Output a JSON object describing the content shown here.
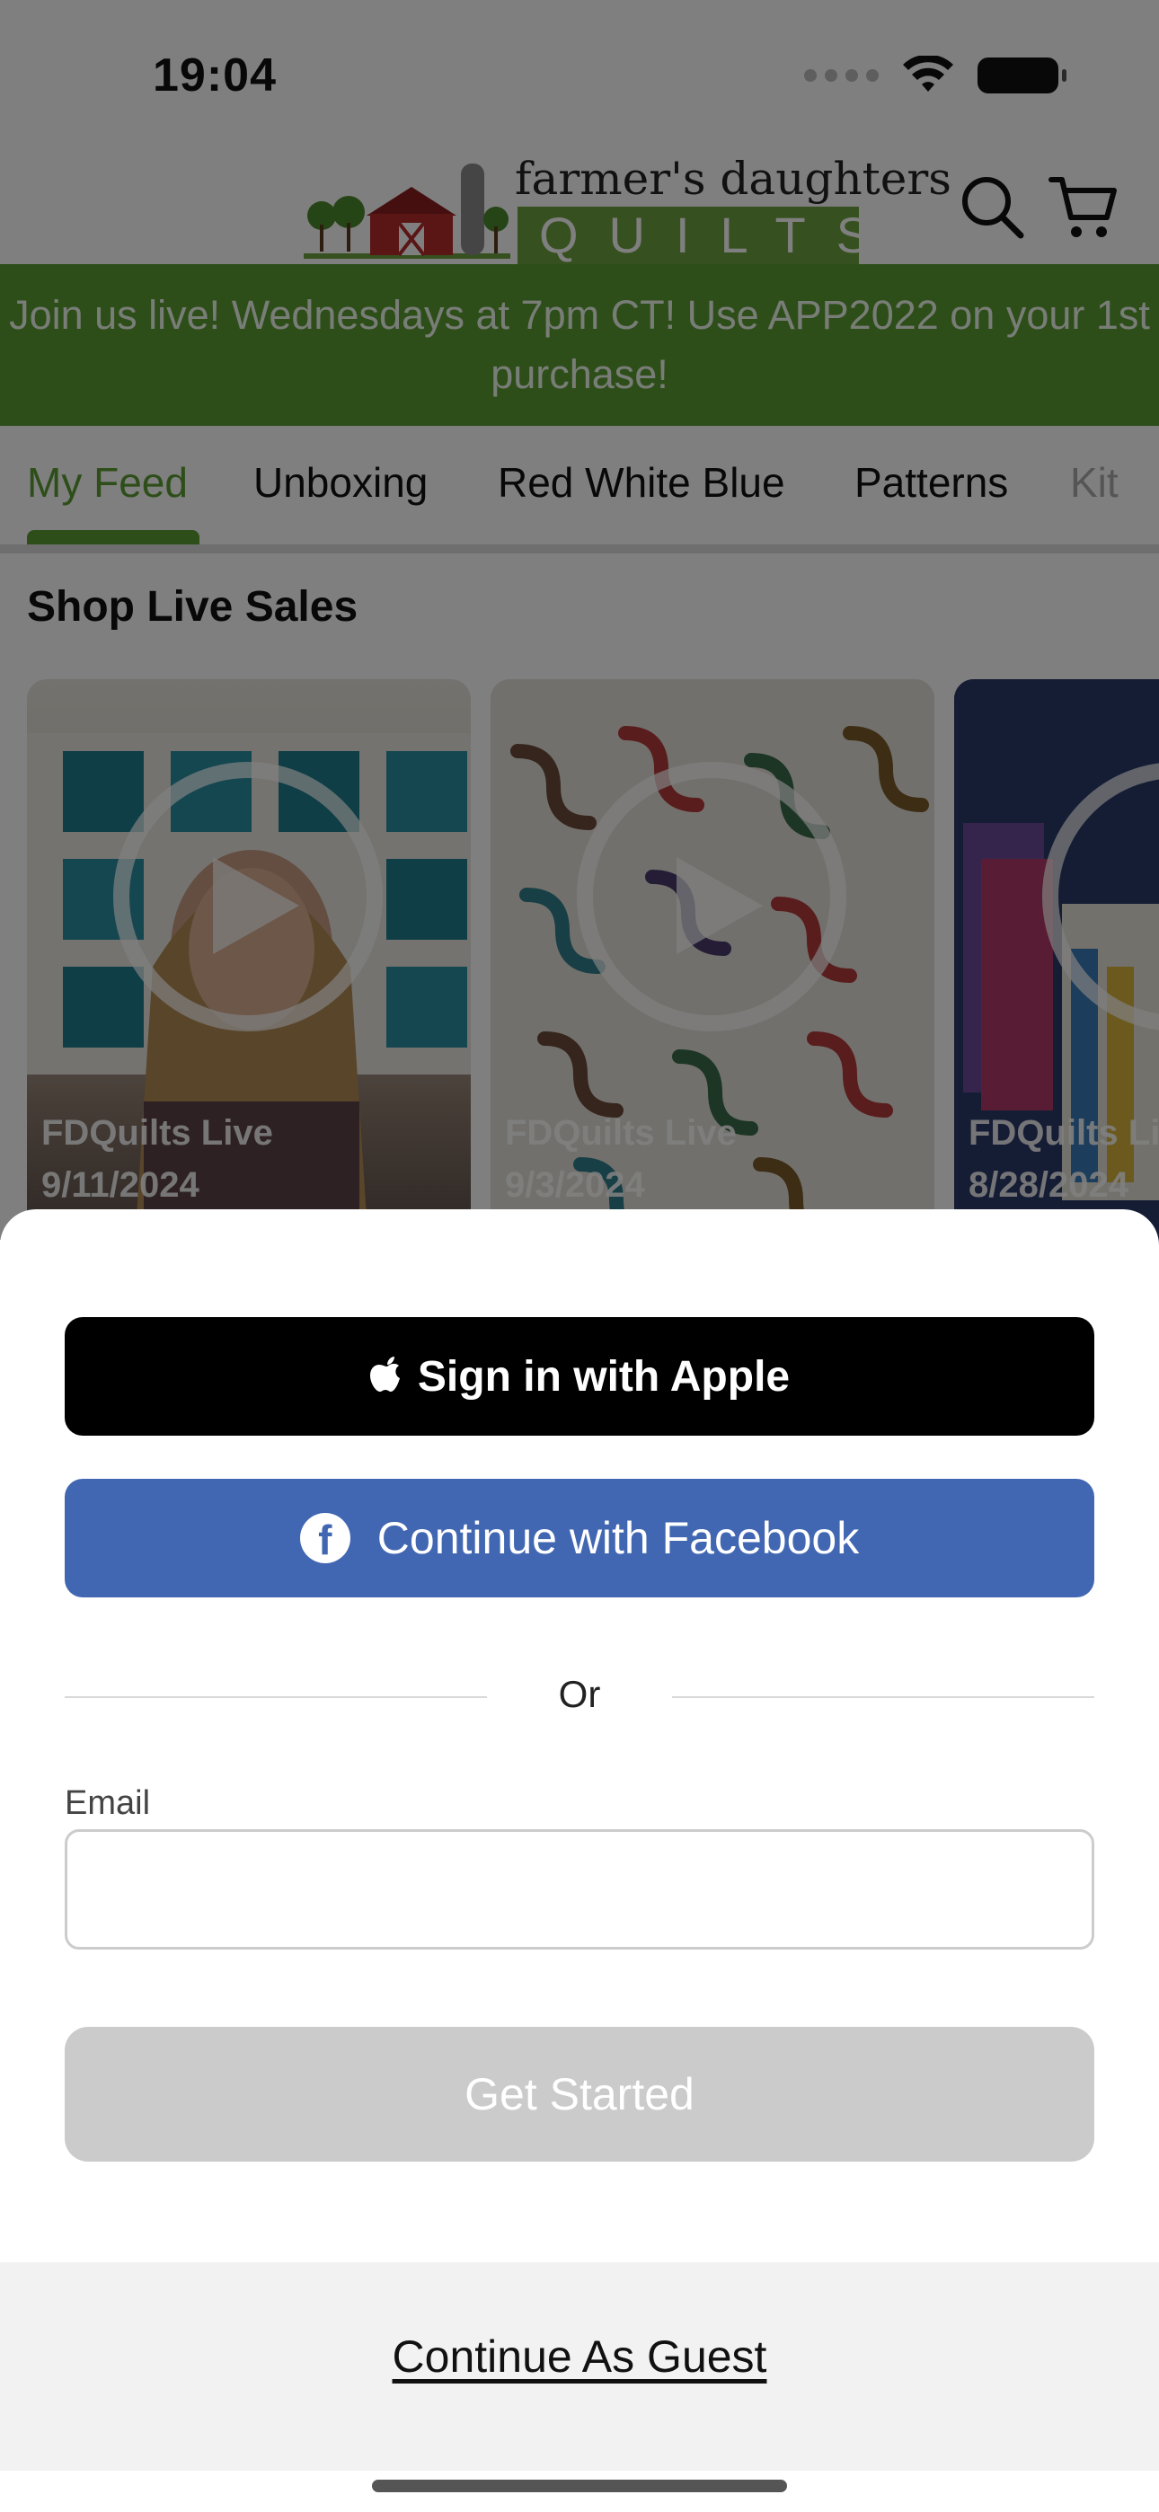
{
  "status_bar": {
    "time": "19:04",
    "icons": [
      "signal-dots-icon",
      "wifi-icon",
      "battery-icon"
    ]
  },
  "header": {
    "logo_script": "farmer's daughters",
    "logo_box": "QUILTS",
    "icons": [
      "barn-logo-icon",
      "search-icon",
      "cart-icon"
    ]
  },
  "promo_banner": {
    "text": "Join us live! Wednesdays at 7pm CT! Use APP2022 on your 1st purchase!"
  },
  "tabs": [
    {
      "label": "My Feed",
      "active": true
    },
    {
      "label": "Unboxing",
      "active": false
    },
    {
      "label": "Red White Blue",
      "active": false
    },
    {
      "label": "Patterns",
      "active": false
    },
    {
      "label": "Kit",
      "active": false
    }
  ],
  "section": {
    "title": "Shop Live Sales"
  },
  "videos": [
    {
      "title": "FDQuilts Live",
      "date": "9/11/2024"
    },
    {
      "title": "FDQuilts Live",
      "date": "9/3/2024"
    },
    {
      "title": "FDQuilts Li",
      "date": "8/28/2024"
    }
  ],
  "sheet": {
    "apple_button": "Sign in with Apple",
    "facebook_button": "Continue with Facebook",
    "divider": "Or",
    "email_label": "Email",
    "email_value": "",
    "email_placeholder": "",
    "get_started_button": "Get Started",
    "guest_link": "Continue As Guest"
  },
  "colors": {
    "brand_green": "#5b9c32",
    "facebook_blue": "#4267b2",
    "apple_black": "#000000",
    "disabled_gray": "#cbcbcb",
    "overlay": "rgba(0,0,0,0.5)"
  }
}
